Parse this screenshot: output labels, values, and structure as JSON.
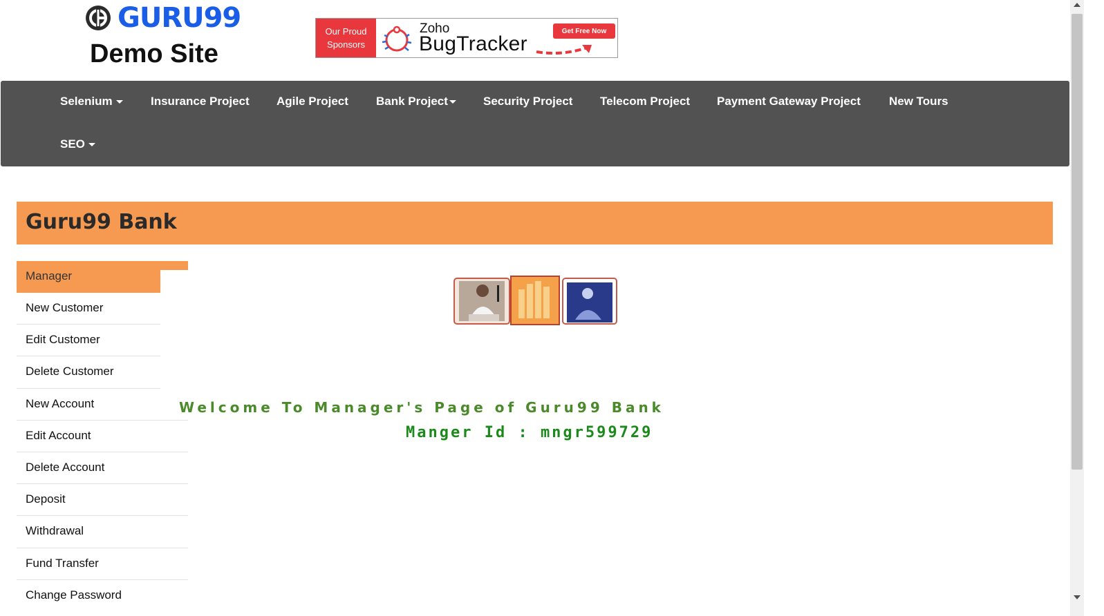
{
  "header": {
    "logo_text": "GURU99",
    "logo_subtitle": "Demo Site",
    "sponsor": {
      "left_line1": "Our Proud",
      "left_line2": "Sponsors",
      "brand_small": "Zoho",
      "brand_large": "BugTracker",
      "cta": "Get Free Now"
    }
  },
  "nav": {
    "items": [
      {
        "label": "Selenium",
        "dropdown": true
      },
      {
        "label": "Insurance Project",
        "dropdown": false
      },
      {
        "label": "Agile Project",
        "dropdown": false
      },
      {
        "label": "Bank Project",
        "dropdown": true
      },
      {
        "label": "Security Project",
        "dropdown": false
      },
      {
        "label": "Telecom Project",
        "dropdown": false
      },
      {
        "label": "Payment Gateway Project",
        "dropdown": false
      },
      {
        "label": "New Tours",
        "dropdown": false
      },
      {
        "label": "SEO",
        "dropdown": true
      }
    ]
  },
  "bank": {
    "title": "Guru99 Bank"
  },
  "sidebar": {
    "header": "Manager",
    "items": [
      {
        "label": "New Customer"
      },
      {
        "label": "Edit Customer"
      },
      {
        "label": "Delete Customer"
      },
      {
        "label": "New Account"
      },
      {
        "label": "Edit Account"
      },
      {
        "label": "Delete Account"
      },
      {
        "label": "Deposit"
      },
      {
        "label": "Withdrawal"
      },
      {
        "label": "Fund Transfer"
      },
      {
        "label": "Change Password"
      }
    ]
  },
  "main": {
    "welcome": "Welcome To Manager's Page of Guru99 Bank",
    "manager_id": "Manger Id : mngr599729"
  },
  "colors": {
    "accent_orange": "#f79a51",
    "nav_gray": "#525252",
    "brand_blue": "#1a5de6",
    "sponsor_red": "#e8383d",
    "welcome_green": "#4a8a2a",
    "id_green": "#1b8a1b"
  }
}
